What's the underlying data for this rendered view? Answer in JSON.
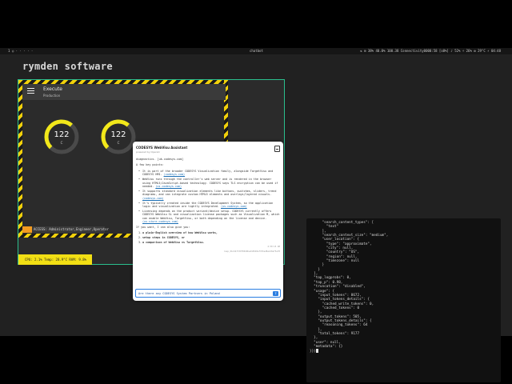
{
  "topbar": {
    "workspaces": "1 ◎ · · · · ·",
    "app": "chatbot",
    "tray": "⇅  ⊞  38%  40.0%  100.38  Connectivity0000:58 [o8%]  ♪ 52%  ☼ 26%  ⚙  29°C ⚡  04:48"
  },
  "brand": "rymden software",
  "hmi": {
    "title": "Execute",
    "subtitle": "Production",
    "gauges": [
      {
        "value": "122",
        "unit": "C",
        "level": 0.65
      },
      {
        "value": "122",
        "unit": "C",
        "level": 0.65
      }
    ],
    "access": "ACCESS: Administrator,Engineer,Operator",
    "status": "CPU: 2.1%  Temp: 28.9°C  RAM: 9.8%",
    "colors": {
      "accent": "#2bbf8e",
      "hazard": "#f2d10a",
      "gauge": "#f2e81a"
    }
  },
  "chat": {
    "title": "CODESYS WebVisu Assistant",
    "subtitle": "powered by OpenAI",
    "intro": "diagnostics. [uk.codesys.com]",
    "key_points_label": "A few key points:",
    "points": [
      {
        "text": "It is part of the broader CODESYS Visualization family, alongside TargetVisu and CODESYS HMI.",
        "link": "(codesys.com)"
      },
      {
        "text": "WebVisu runs through the controller's web server and is rendered in the browser using HTML5/JavaScript-based technology. CODESYS says TLS encryption can be used if needed.",
        "link": "(us.codesys.com)"
      },
      {
        "text": "It supports standard visualization elements like buttons, switches, sliders, trend diagrams, and can integrate custom HTML5 elements and overlays/layered visuals.",
        "link": "(codesys.com)"
      },
      {
        "text": "It's typically created inside the CODESYS Development System, so the application logic and visualization are tightly integrated.",
        "link": "(us.codesys.com)"
      },
      {
        "text": "Licensing depends on the product variant/device setup. CODESYS currently offers CODESYS WebVisu SL and visualization license packages such as Visualization M, which can enable WebVisu, TargetVisu, or both depending on the license and device.",
        "link": "(us.store.codesys.com)"
      }
    ],
    "offer": "If you want, I can also give you:",
    "options": [
      "a plain-English overview of how WebVisu works,",
      "setup steps in CODESYS, or",
      "a comparison of WebVisu vs TargetVisu."
    ],
    "meta_time": "4:39:15 AM",
    "meta_id": "resp_0bc6b77d9f8040bad189d0ef7b5ed8e1d9ef5a78",
    "input_value": "Are there any CODESYS System Partners in Poland",
    "input_placeholder": "Type your message…"
  },
  "terminal": {
    "lines": [
      "      \"search_content_types\": [",
      "        \"text\"",
      "      ],",
      "      \"search_context_size\": \"medium\",",
      "      \"user_location\": {",
      "        \"type\": \"approximate\",",
      "        \"city\": null,",
      "        \"country\": \"US\",",
      "        \"region\": null,",
      "        \"timezone\": null",
      "      }",
      "    }",
      "  ],",
      "  \"top_logprobs\": 0,",
      "  \"top_p\": 0.98,",
      "  \"truncation\": \"disabled\",",
      "  \"usage\": {",
      "    \"input_tokens\": 8672,",
      "    \"input_tokens_details\": {",
      "      \"cached_write_tokens\": 0,",
      "      \"cached_tokens\": 0",
      "    },",
      "    \"output_tokens\": 505,",
      "    \"output_tokens_details\": {",
      "      \"reasoning_tokens\": 64",
      "    },",
      "    \"total_tokens\": 9177",
      "  },",
      "  \"user\": null,",
      "  \"metadata\": {}",
      "}}}"
    ]
  }
}
